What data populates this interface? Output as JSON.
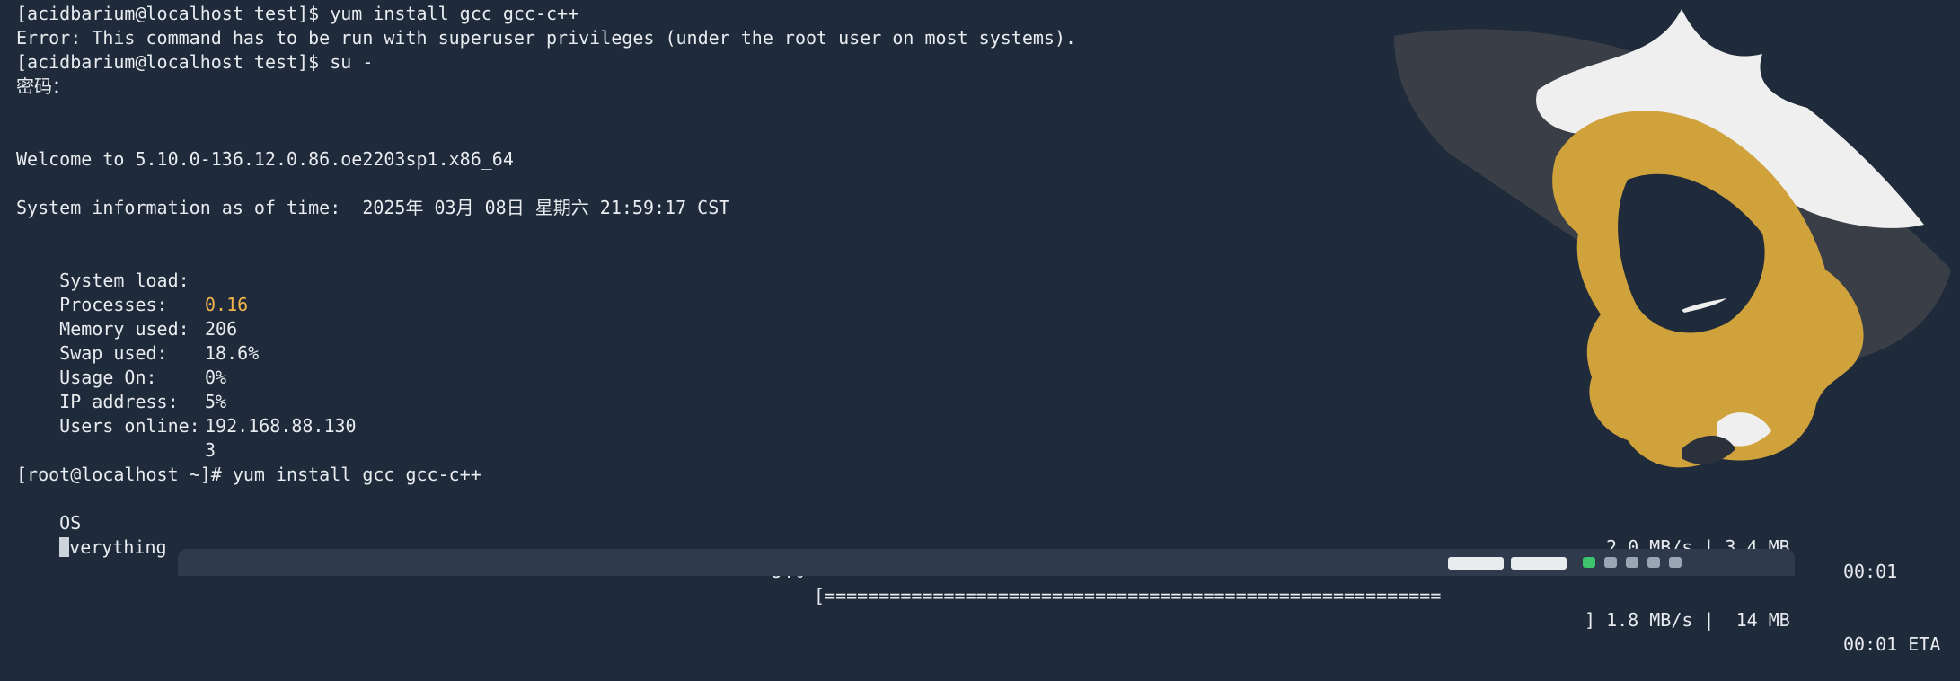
{
  "terminal": {
    "prompt1": "[acidbarium@localhost test]$ yum install gcc gcc-c++",
    "error": "Error: This command has to be run with superuser privileges (under the root user on most systems).",
    "prompt2": "[acidbarium@localhost test]$ su -",
    "password_prompt": "密码：",
    "welcome": "Welcome to 5.10.0-136.12.0.86.oe2203sp1.x86_64",
    "sysinfo_time": "System information as of time:  2025年 03月 08日 星期六 21:59:17 CST",
    "stats": [
      {
        "label": "System load:",
        "value": "0.16"
      },
      {
        "label": "Processes:",
        "value": "206"
      },
      {
        "label": "Memory used:",
        "value": "18.6%"
      },
      {
        "label": "Swap used:",
        "value": "0%"
      },
      {
        "label": "Usage On:",
        "value": "5%"
      },
      {
        "label": "IP address:",
        "value": "192.168.88.130"
      },
      {
        "label": "Users online:",
        "value": "3"
      }
    ],
    "root_prompt": "[root@localhost ~]# yum install gcc gcc-c++",
    "os_line": {
      "name": "OS",
      "rate_size": "2.0 MB/s | 3.4 MB",
      "time": "00:01"
    },
    "everything_line": {
      "name": "verything",
      "percent": "84%",
      "bar": "[=========================================================",
      "rate_size": "] 1.8 MB/s |  14 MB",
      "eta": "00:01 ETA"
    }
  },
  "colors": {
    "background": "#1f2a3a",
    "text": "#e8ebef",
    "highlight": "#f0b44c",
    "art_hair": "#d0a23c",
    "art_hat": "#3a3f47",
    "art_white": "#efefef"
  }
}
